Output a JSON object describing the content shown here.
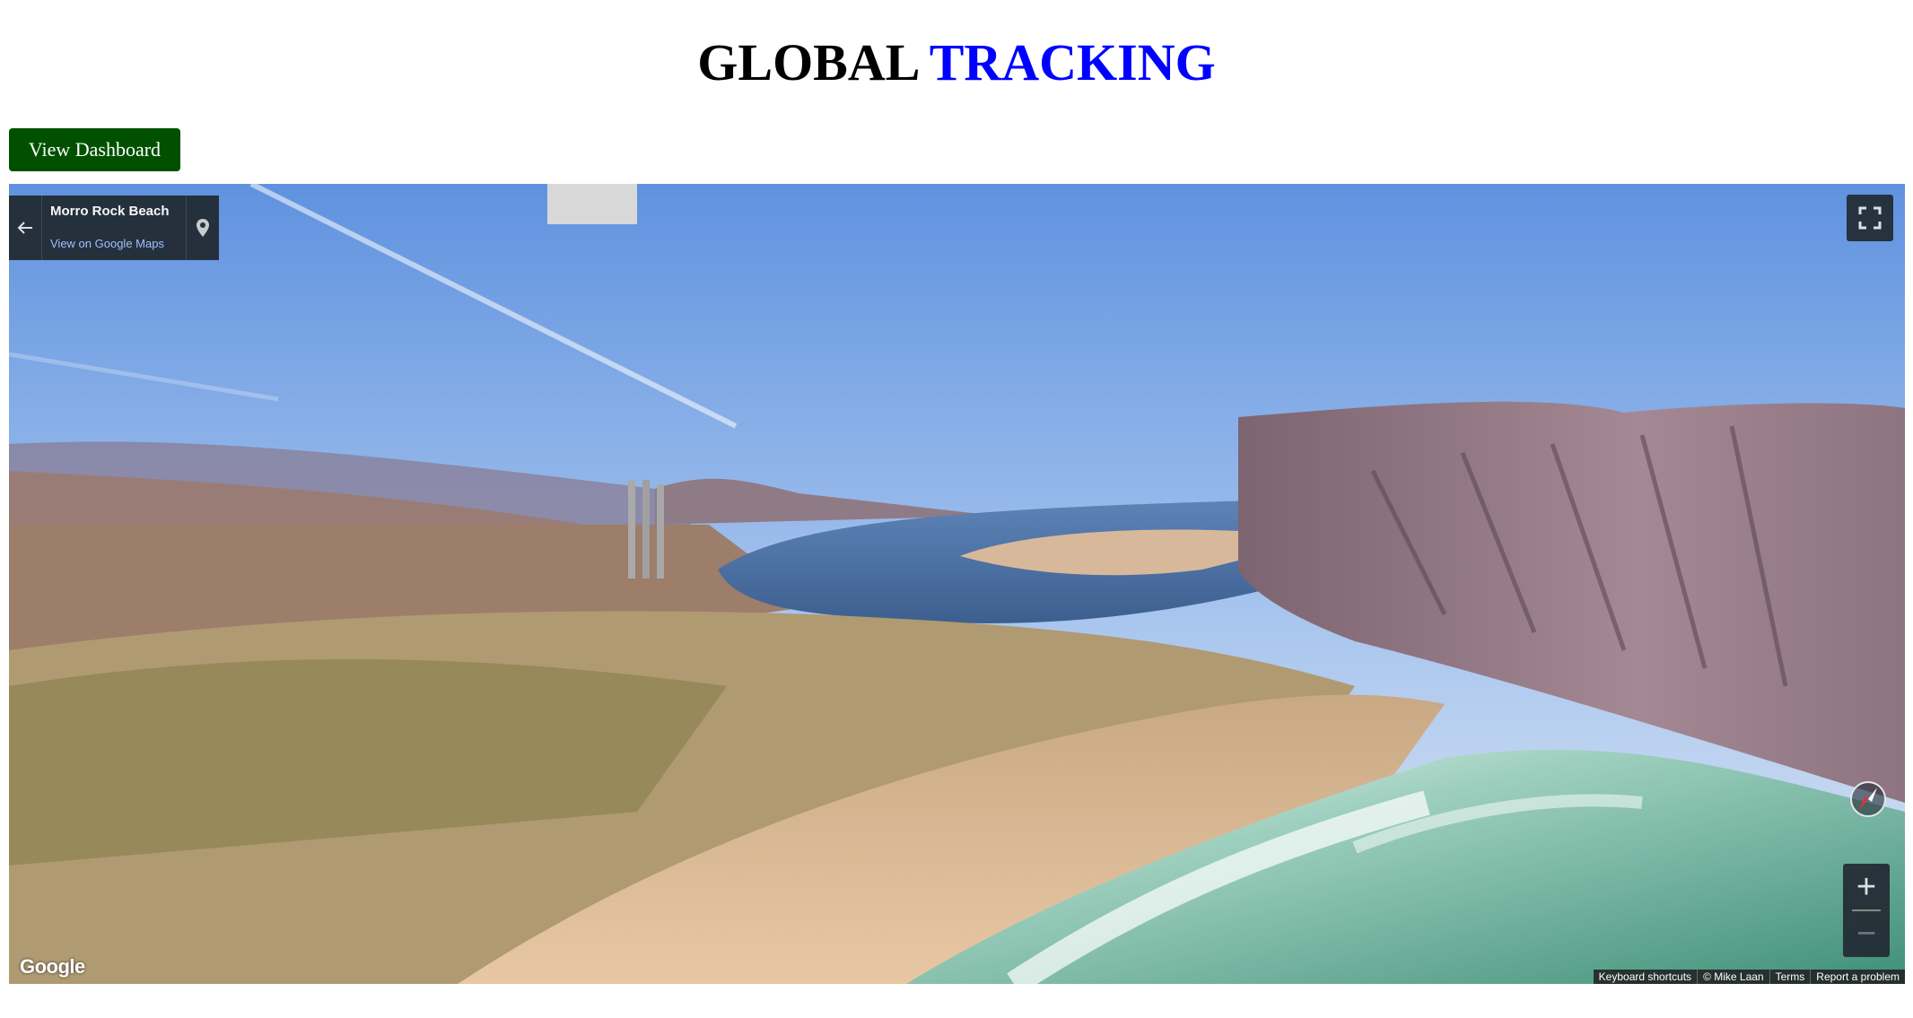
{
  "header": {
    "title_part1": "GLOBAL",
    "title_part2": "TRACKING",
    "colors": {
      "part1": "#000000",
      "part2": "#0000ff"
    }
  },
  "actions": {
    "dashboard_label": "View Dashboard",
    "dashboard_color": "#005000"
  },
  "streetview": {
    "place_name": "Morro Rock Beach",
    "map_link": "View on Google Maps",
    "icons": {
      "back": "arrow-left-icon",
      "pin": "map-pin-icon",
      "fullscreen": "fullscreen-icon",
      "compass": "compass-icon",
      "zoom_in": "plus-icon",
      "zoom_out": "minus-icon"
    },
    "zoom_in_label": "+",
    "zoom_out_label": "−",
    "logo": "Google",
    "footer": {
      "keyboard": "Keyboard shortcuts",
      "credit": "© Mike Laan",
      "terms": "Terms",
      "report": "Report a problem"
    }
  }
}
